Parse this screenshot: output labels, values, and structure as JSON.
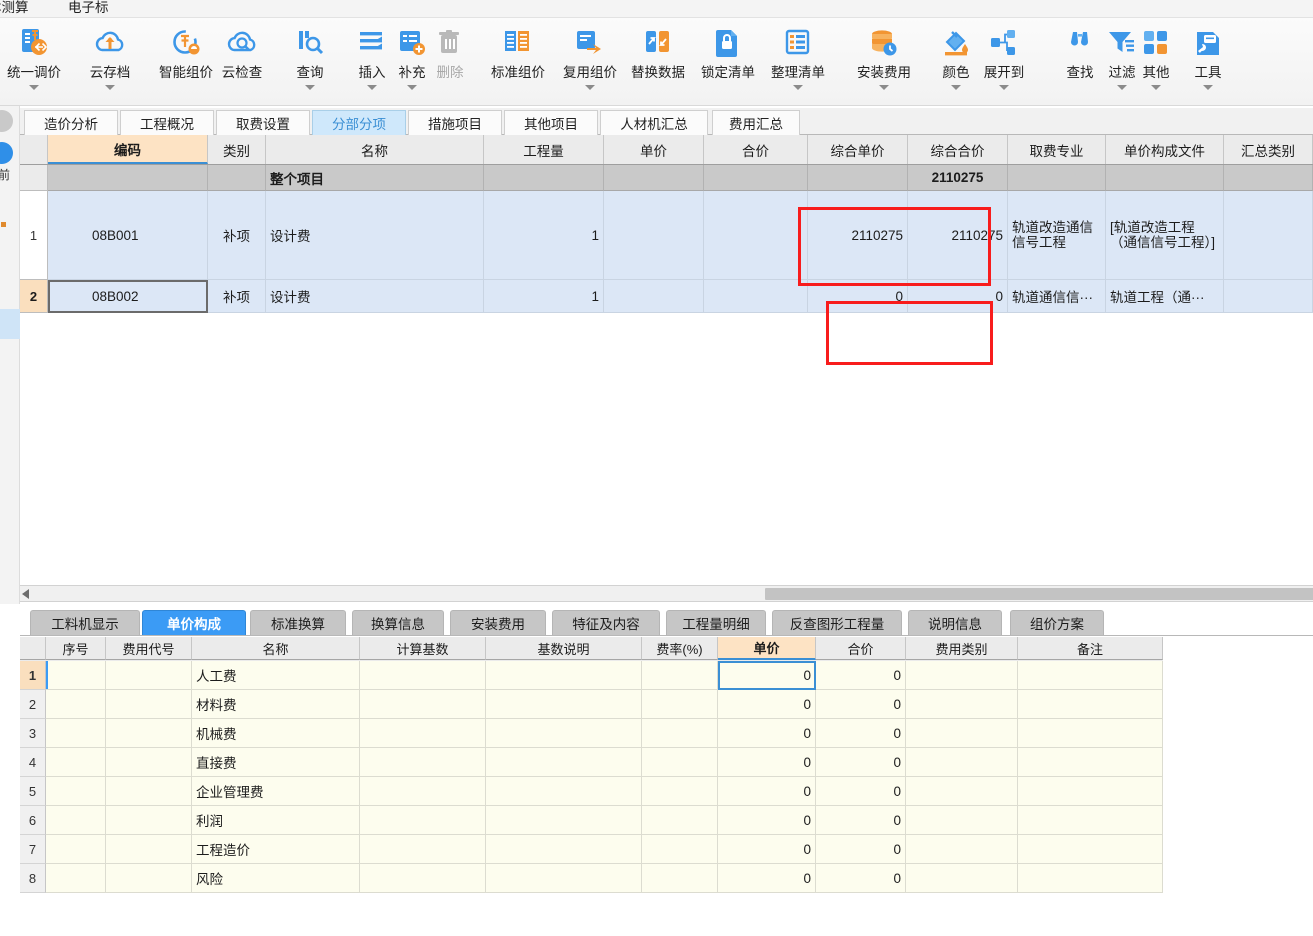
{
  "menubar": {
    "items": [
      {
        "label": "本测算"
      },
      {
        "label": "电子标"
      }
    ]
  },
  "ribbon": {
    "buttons": [
      {
        "label": "统一调价",
        "icon": "unified-price-icon",
        "caret": true,
        "disabled": false
      },
      {
        "label": "云存档",
        "icon": "cloud-archive-icon",
        "caret": true,
        "disabled": false
      },
      {
        "label": "智能组价",
        "icon": "smart-pricing-icon",
        "caret": false,
        "disabled": false
      },
      {
        "label": "云检查",
        "icon": "cloud-check-icon",
        "caret": false,
        "disabled": false
      },
      {
        "label": "查询",
        "icon": "query-icon",
        "caret": true,
        "disabled": false
      },
      {
        "label": "插入",
        "icon": "insert-icon",
        "caret": true,
        "disabled": false
      },
      {
        "label": "补充",
        "icon": "supplement-icon",
        "caret": true,
        "disabled": false
      },
      {
        "label": "删除",
        "icon": "delete-icon",
        "caret": false,
        "disabled": true
      },
      {
        "label": "标准组价",
        "icon": "standard-price-icon",
        "caret": false,
        "disabled": false
      },
      {
        "label": "复用组价",
        "icon": "reuse-price-icon",
        "caret": true,
        "disabled": false
      },
      {
        "label": "替换数据",
        "icon": "replace-data-icon",
        "caret": false,
        "disabled": false
      },
      {
        "label": "锁定清单",
        "icon": "lock-list-icon",
        "caret": false,
        "disabled": false
      },
      {
        "label": "整理清单",
        "icon": "organize-list-icon",
        "caret": true,
        "disabled": false
      },
      {
        "label": "安装费用",
        "icon": "install-fee-icon",
        "caret": true,
        "disabled": false
      },
      {
        "label": "颜色",
        "icon": "color-icon",
        "caret": true,
        "disabled": false
      },
      {
        "label": "展开到",
        "icon": "expand-to-icon",
        "caret": true,
        "disabled": false
      },
      {
        "label": "查找",
        "icon": "find-icon",
        "caret": false,
        "disabled": false
      },
      {
        "label": "过滤",
        "icon": "filter-icon",
        "caret": true,
        "disabled": false
      },
      {
        "label": "其他",
        "icon": "other-icon",
        "caret": true,
        "disabled": false
      },
      {
        "label": "工具",
        "icon": "tools-icon",
        "caret": true,
        "disabled": false
      }
    ]
  },
  "main_tabs": [
    {
      "label": "造价分析",
      "active": false
    },
    {
      "label": "工程概况",
      "active": false
    },
    {
      "label": "取费设置",
      "active": false
    },
    {
      "label": "分部分项",
      "active": true
    },
    {
      "label": "措施项目",
      "active": false
    },
    {
      "label": "其他项目",
      "active": false
    },
    {
      "label": "人材机汇总",
      "active": false
    },
    {
      "label": "费用汇总",
      "active": false
    }
  ],
  "top_grid": {
    "columns": [
      {
        "label": "编码",
        "selected": true
      },
      {
        "label": "类别",
        "selected": false
      },
      {
        "label": "名称",
        "selected": false
      },
      {
        "label": "工程量",
        "selected": false
      },
      {
        "label": "单价",
        "selected": false
      },
      {
        "label": "合价",
        "selected": false
      },
      {
        "label": "综合单价",
        "selected": false
      },
      {
        "label": "综合合价",
        "selected": false
      },
      {
        "label": "取费专业",
        "selected": false
      },
      {
        "label": "单价构成文件",
        "selected": false
      },
      {
        "label": "汇总类别",
        "selected": false
      }
    ],
    "rows": [
      {
        "rownum": "",
        "code": "",
        "category": "",
        "name": "整个项目",
        "quantity": "",
        "unit_price": "",
        "total_price": "",
        "comp_unit_price": "",
        "comp_total_price": "2110275",
        "fee_specialty": "",
        "price_file": "",
        "summary_category": ""
      },
      {
        "rownum": "1",
        "code": "08B001",
        "category": "补项",
        "name": "设计费",
        "quantity": "1",
        "unit_price": "",
        "total_price": "",
        "comp_unit_price": "2110275",
        "comp_total_price": "2110275",
        "fee_specialty": "轨道改造通信信号工程",
        "price_file": "[轨道改造工程（通信信号工程）]",
        "summary_category": ""
      },
      {
        "rownum": "2",
        "code": "08B002",
        "category": "补项",
        "name": "设计费",
        "quantity": "1",
        "unit_price": "",
        "total_price": "",
        "comp_unit_price": "0",
        "comp_total_price": "0",
        "fee_specialty": "轨道通信信···",
        "price_file": "轨道工程（通···",
        "summary_category": ""
      }
    ]
  },
  "highlight_color": "#f81c1c",
  "bottom_tabs": [
    {
      "label": "工料机显示",
      "active": false
    },
    {
      "label": "单价构成",
      "active": true
    },
    {
      "label": "标准换算",
      "active": false
    },
    {
      "label": "换算信息",
      "active": false
    },
    {
      "label": "安装费用",
      "active": false
    },
    {
      "label": "特征及内容",
      "active": false
    },
    {
      "label": "工程量明细",
      "active": false
    },
    {
      "label": "反查图形工程量",
      "active": false
    },
    {
      "label": "说明信息",
      "active": false
    },
    {
      "label": "组价方案",
      "active": false
    }
  ],
  "bottom_grid": {
    "columns": [
      {
        "label": "序号",
        "selected": false
      },
      {
        "label": "费用代号",
        "selected": false
      },
      {
        "label": "名称",
        "selected": false
      },
      {
        "label": "计算基数",
        "selected": false
      },
      {
        "label": "基数说明",
        "selected": false
      },
      {
        "label": "费率(%)",
        "selected": false
      },
      {
        "label": "单价",
        "selected": true
      },
      {
        "label": "合价",
        "selected": false
      },
      {
        "label": "费用类别",
        "selected": false
      },
      {
        "label": "备注",
        "selected": false
      }
    ],
    "rows": [
      {
        "rownum": "1",
        "seq": "",
        "fee_code": "",
        "name": "人工费",
        "base": "",
        "base_desc": "",
        "rate": "",
        "unit_price": "0",
        "total_price": "0",
        "fee_category": "",
        "remark": ""
      },
      {
        "rownum": "2",
        "seq": "",
        "fee_code": "",
        "name": "材料费",
        "base": "",
        "base_desc": "",
        "rate": "",
        "unit_price": "0",
        "total_price": "0",
        "fee_category": "",
        "remark": ""
      },
      {
        "rownum": "3",
        "seq": "",
        "fee_code": "",
        "name": "机械费",
        "base": "",
        "base_desc": "",
        "rate": "",
        "unit_price": "0",
        "total_price": "0",
        "fee_category": "",
        "remark": ""
      },
      {
        "rownum": "4",
        "seq": "",
        "fee_code": "",
        "name": "直接费",
        "base": "",
        "base_desc": "",
        "rate": "",
        "unit_price": "0",
        "total_price": "0",
        "fee_category": "",
        "remark": ""
      },
      {
        "rownum": "5",
        "seq": "",
        "fee_code": "",
        "name": "企业管理费",
        "base": "",
        "base_desc": "",
        "rate": "",
        "unit_price": "0",
        "total_price": "0",
        "fee_category": "",
        "remark": ""
      },
      {
        "rownum": "6",
        "seq": "",
        "fee_code": "",
        "name": "利润",
        "base": "",
        "base_desc": "",
        "rate": "",
        "unit_price": "0",
        "total_price": "0",
        "fee_category": "",
        "remark": ""
      },
      {
        "rownum": "7",
        "seq": "",
        "fee_code": "",
        "name": "工程造价",
        "base": "",
        "base_desc": "",
        "rate": "",
        "unit_price": "0",
        "total_price": "0",
        "fee_category": "",
        "remark": ""
      },
      {
        "rownum": "8",
        "seq": "",
        "fee_code": "",
        "name": "风险",
        "base": "",
        "base_desc": "",
        "rate": "",
        "unit_price": "0",
        "total_price": "0",
        "fee_category": "",
        "remark": ""
      }
    ]
  }
}
